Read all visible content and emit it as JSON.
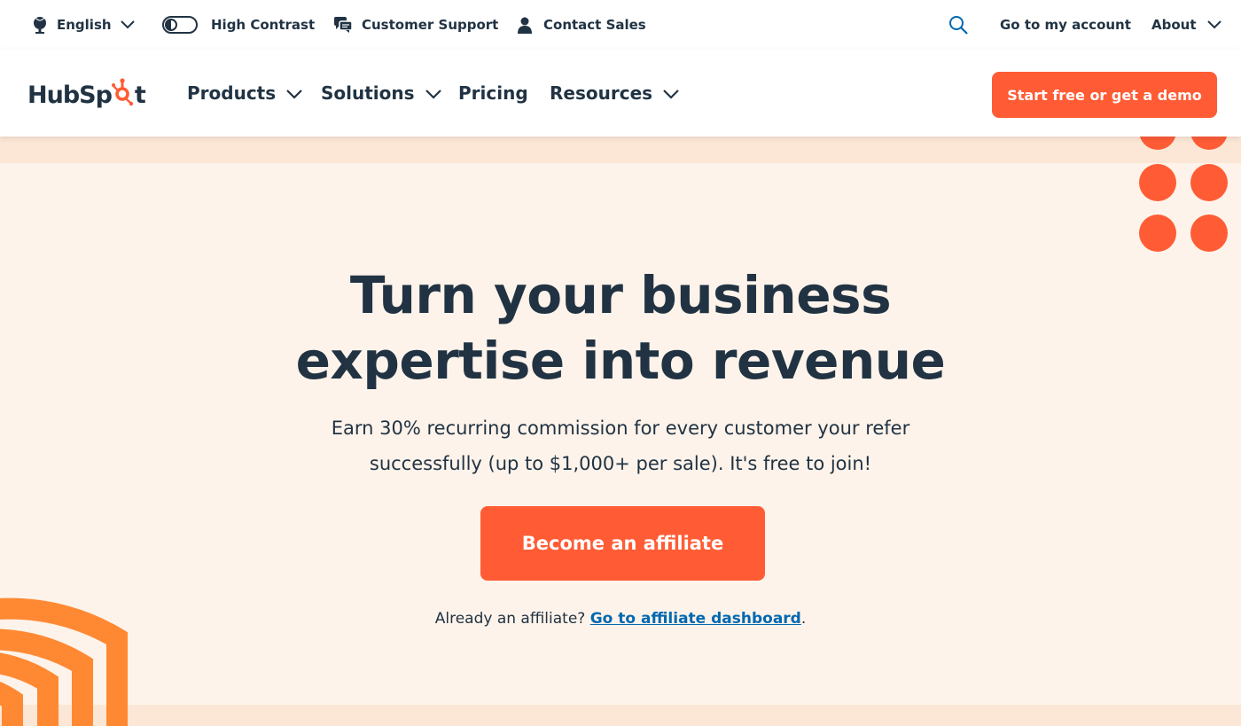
{
  "utility": {
    "language": "English",
    "contrast": "High Contrast",
    "support": "Customer Support",
    "sales": "Contact Sales",
    "account": "Go to my account",
    "about": "About"
  },
  "logo": {
    "pre": "HubSp",
    "post": "t"
  },
  "nav": {
    "products": "Products",
    "solutions": "Solutions",
    "pricing": "Pricing",
    "resources": "Resources",
    "cta": "Start free or get a demo"
  },
  "hero": {
    "title_line1": "Turn your business",
    "title_line2": "expertise into revenue",
    "subtitle_line1": "Earn 30% recurring commission for every customer your refer",
    "subtitle_line2": "successfully (up to $1,000+ per sale). It's free to join!",
    "cta": "Become an affiliate",
    "already_text": "Already an affiliate? ",
    "dashboard_link": "Go to affiliate dashboard",
    "period": "."
  },
  "colors": {
    "brand": "#ff5c35",
    "ink": "#213343",
    "link": "#0068b1",
    "hero_bg": "#fdf3ea",
    "arc": "#ff8933"
  },
  "icons": [
    "globe-icon",
    "toggle-icon",
    "chat-icon",
    "person-icon",
    "search-icon",
    "chevron-down-icon"
  ]
}
